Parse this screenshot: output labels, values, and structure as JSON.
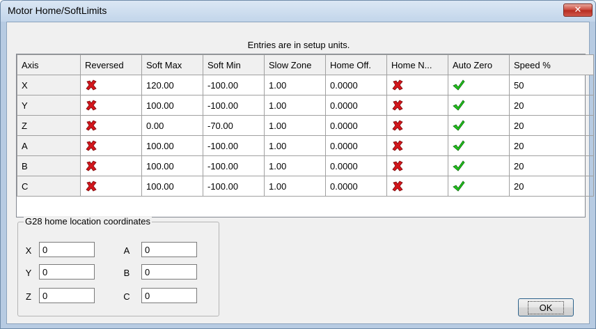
{
  "window": {
    "title": "Motor Home/SoftLimits",
    "close_label": "✕"
  },
  "caption": "Entries are in setup units.",
  "table": {
    "headers": [
      "Axis",
      "Reversed",
      "Soft Max",
      "Soft Min",
      "Slow Zone",
      "Home Off.",
      "Home N...",
      "Auto Zero",
      "Speed %"
    ],
    "rows": [
      {
        "axis": "X",
        "reversed": "x-icon",
        "soft_max": "120.00",
        "soft_min": "-100.00",
        "slow_zone": "1.00",
        "home_off": "0.0000",
        "home_neg": "x-icon",
        "auto_zero": "check-icon",
        "speed": "50"
      },
      {
        "axis": "Y",
        "reversed": "x-icon",
        "soft_max": "100.00",
        "soft_min": "-100.00",
        "slow_zone": "1.00",
        "home_off": "0.0000",
        "home_neg": "x-icon",
        "auto_zero": "check-icon",
        "speed": "20"
      },
      {
        "axis": "Z",
        "reversed": "x-icon",
        "soft_max": "0.00",
        "soft_min": "-70.00",
        "slow_zone": "1.00",
        "home_off": "0.0000",
        "home_neg": "x-icon",
        "auto_zero": "check-icon",
        "speed": "20"
      },
      {
        "axis": "A",
        "reversed": "x-icon",
        "soft_max": "100.00",
        "soft_min": "-100.00",
        "slow_zone": "1.00",
        "home_off": "0.0000",
        "home_neg": "x-icon",
        "auto_zero": "check-icon",
        "speed": "20"
      },
      {
        "axis": "B",
        "reversed": "x-icon",
        "soft_max": "100.00",
        "soft_min": "-100.00",
        "slow_zone": "1.00",
        "home_off": "0.0000",
        "home_neg": "x-icon",
        "auto_zero": "check-icon",
        "speed": "20"
      },
      {
        "axis": "C",
        "reversed": "x-icon",
        "soft_max": "100.00",
        "soft_min": "-100.00",
        "slow_zone": "1.00",
        "home_off": "0.0000",
        "home_neg": "x-icon",
        "auto_zero": "check-icon",
        "speed": "20"
      }
    ]
  },
  "g28": {
    "legend": "G28 home location coordinates",
    "fields": [
      {
        "label": "X",
        "value": "0"
      },
      {
        "label": "Y",
        "value": "0"
      },
      {
        "label": "Z",
        "value": "0"
      },
      {
        "label": "A",
        "value": "0"
      },
      {
        "label": "B",
        "value": "0"
      },
      {
        "label": "C",
        "value": "0"
      }
    ]
  },
  "ok_label": "OK",
  "colors": {
    "x_icon": "#d4161c",
    "check_icon": "#21c21c"
  }
}
